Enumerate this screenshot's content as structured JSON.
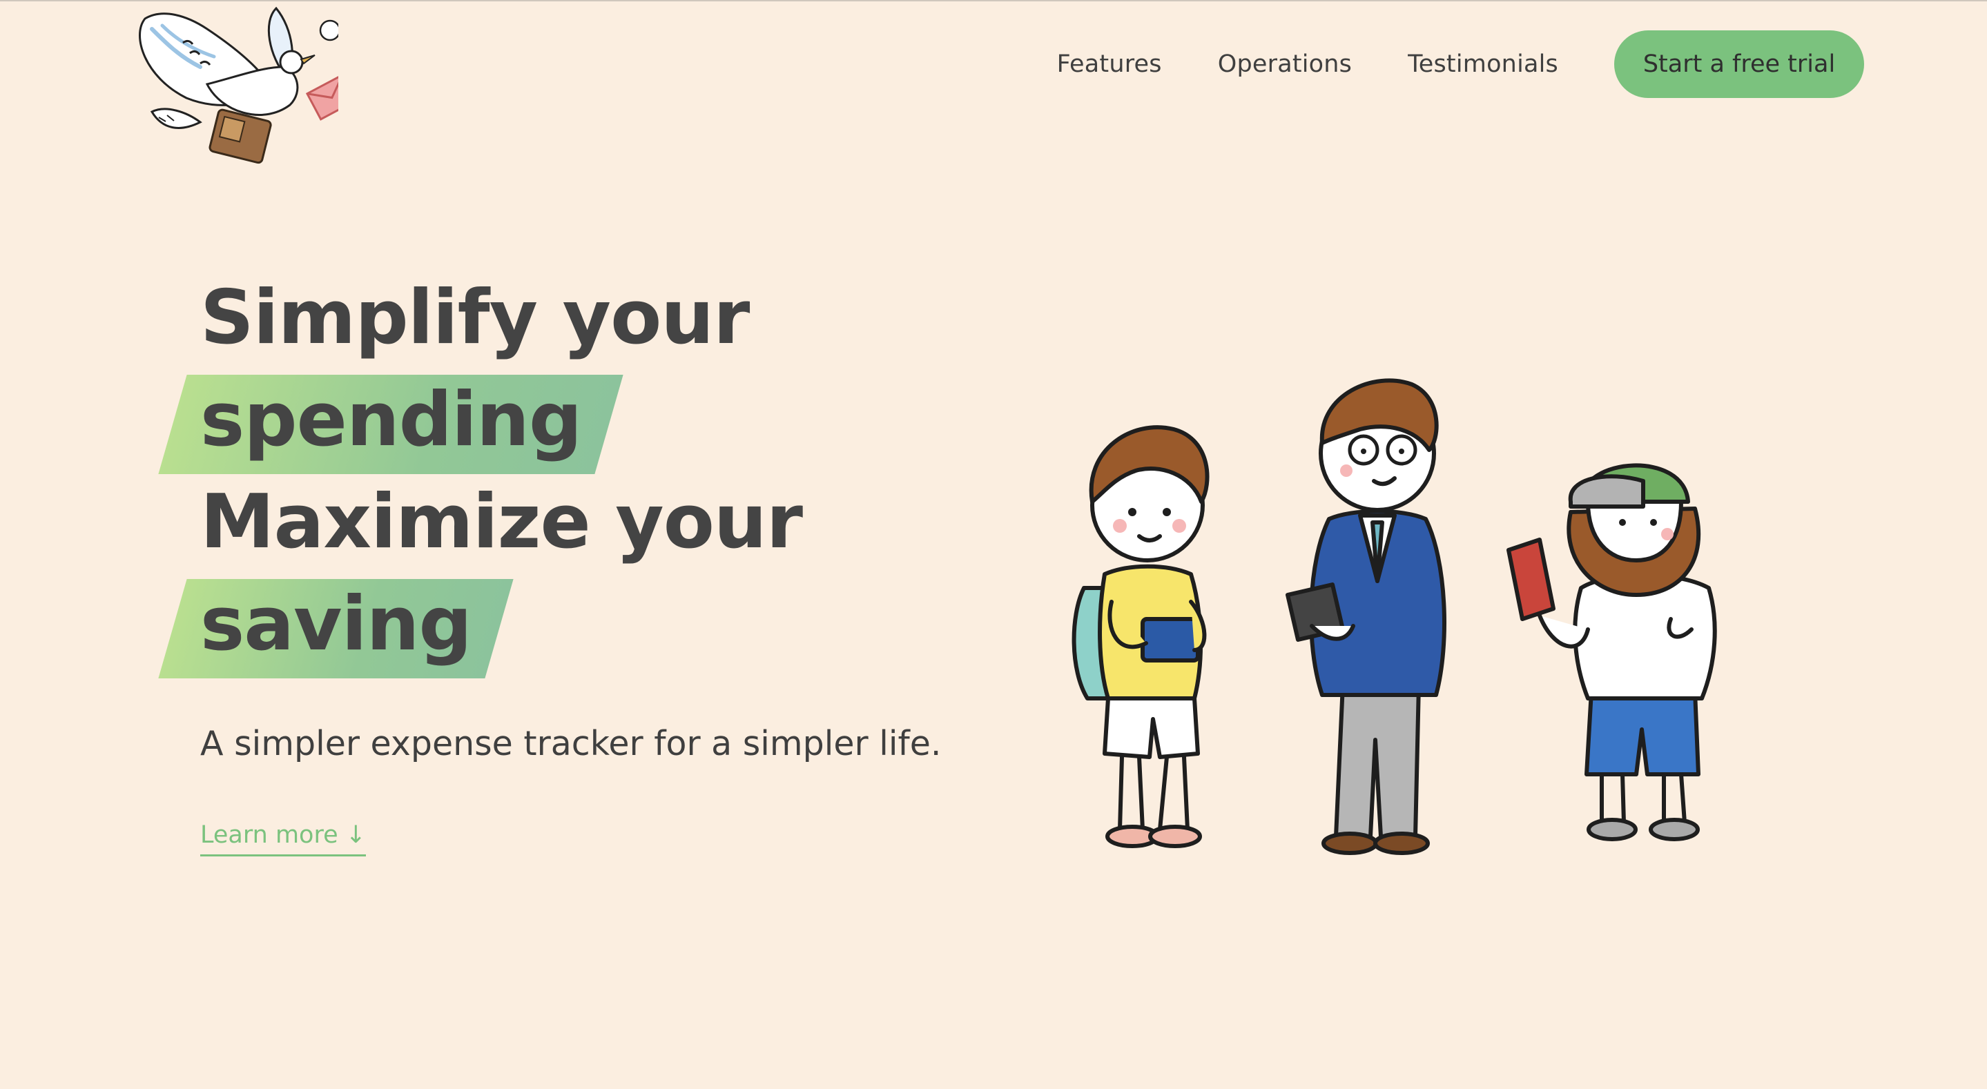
{
  "nav": {
    "links": [
      "Features",
      "Operations",
      "Testimonials"
    ],
    "cta": "Start a free trial"
  },
  "hero": {
    "line1": "Simplify your",
    "line2": "spending",
    "line3": "Maximize your",
    "line4": "saving",
    "subtitle": "A simpler expense tracker for a simpler life.",
    "learn_more": "Learn more ↓"
  },
  "colors": {
    "background": "#fbeee0",
    "accent": "#7bc27e",
    "text": "#444444"
  }
}
